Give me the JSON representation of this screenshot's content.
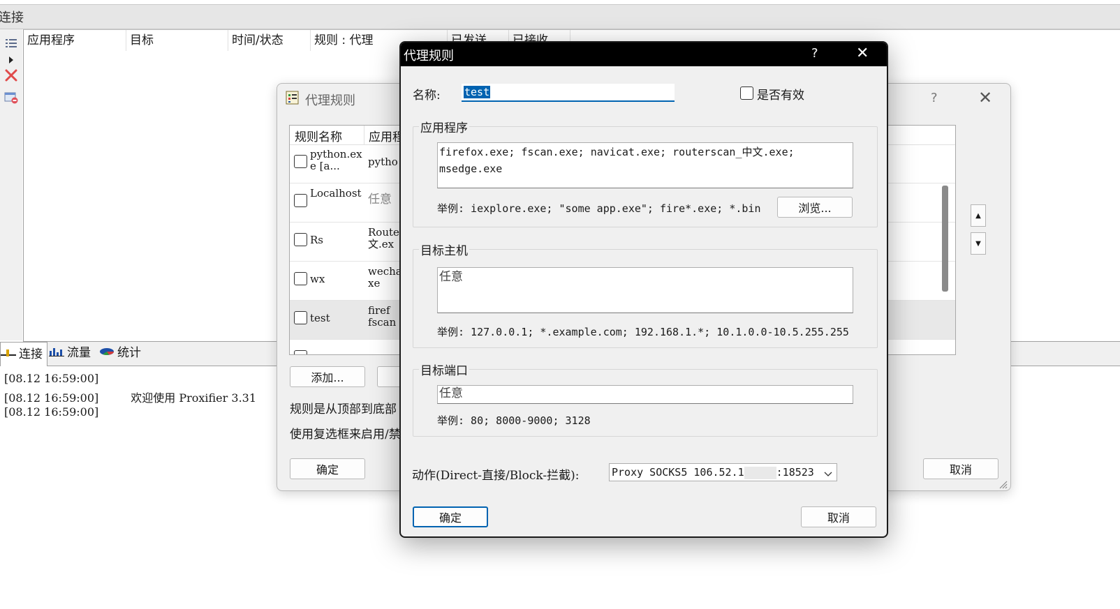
{
  "main": {
    "title": "连接",
    "columns": [
      "应用程序",
      "目标",
      "时间/状态",
      "规则 : 代理",
      "已发送",
      "已接收"
    ],
    "tabs": [
      {
        "label": "连接"
      },
      {
        "label": "流量"
      },
      {
        "label": "统计"
      }
    ],
    "log": [
      {
        "time": "[08.12 16:59:00]",
        "message": ""
      },
      {
        "time": "[08.12 16:59:00]",
        "message": "欢迎使用 Proxifier 3.31"
      },
      {
        "time": "[08.12 16:59:00]",
        "message": ""
      }
    ]
  },
  "rules_dialog": {
    "title": "代理规则",
    "help": "?",
    "close": "✕",
    "columns": [
      "规则名称",
      "应用程"
    ],
    "rules": [
      {
        "name": "python.exe [a...",
        "app": "pytho"
      },
      {
        "name": "Localhost",
        "app": "任意"
      },
      {
        "name": "Rs",
        "app": "Router\n文.ex"
      },
      {
        "name": "wx",
        "app": "wecha\nxe"
      },
      {
        "name": "test",
        "app": "firef\nfscan"
      }
    ],
    "add_button": "添加...",
    "hint1": "规则是从顶部到底部",
    "hint2": "使用复选框来启用/禁",
    "ok": "确定",
    "cancel": "取消"
  },
  "rule_dialog": {
    "title": "代理规则",
    "help": "?",
    "close": "✕",
    "name_label": "名称:",
    "name_value": "test",
    "enabled_label": "是否有效",
    "app_group": "应用程序",
    "app_value": "firefox.exe; fscan.exe; navicat.exe; routerscan_中文.exe;\nmsedge.exe",
    "app_example": "举例: iexplore.exe; \"some app.exe\"; fire*.exe; *.bin",
    "browse_button": "浏览...",
    "host_group": "目标主机",
    "host_value": "任意",
    "host_example": "举例: 127.0.0.1; *.example.com; 192.168.1.*; 10.1.0.0-10.5.255.255",
    "port_group": "目标端口",
    "port_value": "任意",
    "port_example": "举例: 80; 8000-9000; 3128",
    "action_label": "动作(Direct-直接/Block-拦截):",
    "action_value_prefix": "Proxy SOCKS5 106.52.1",
    "action_value_suffix": ":18523",
    "ok": "确定",
    "cancel": "取消"
  },
  "colors": {
    "selection": "#0063b1",
    "focus_border": "#0063b1",
    "title_bar": "#000000"
  }
}
